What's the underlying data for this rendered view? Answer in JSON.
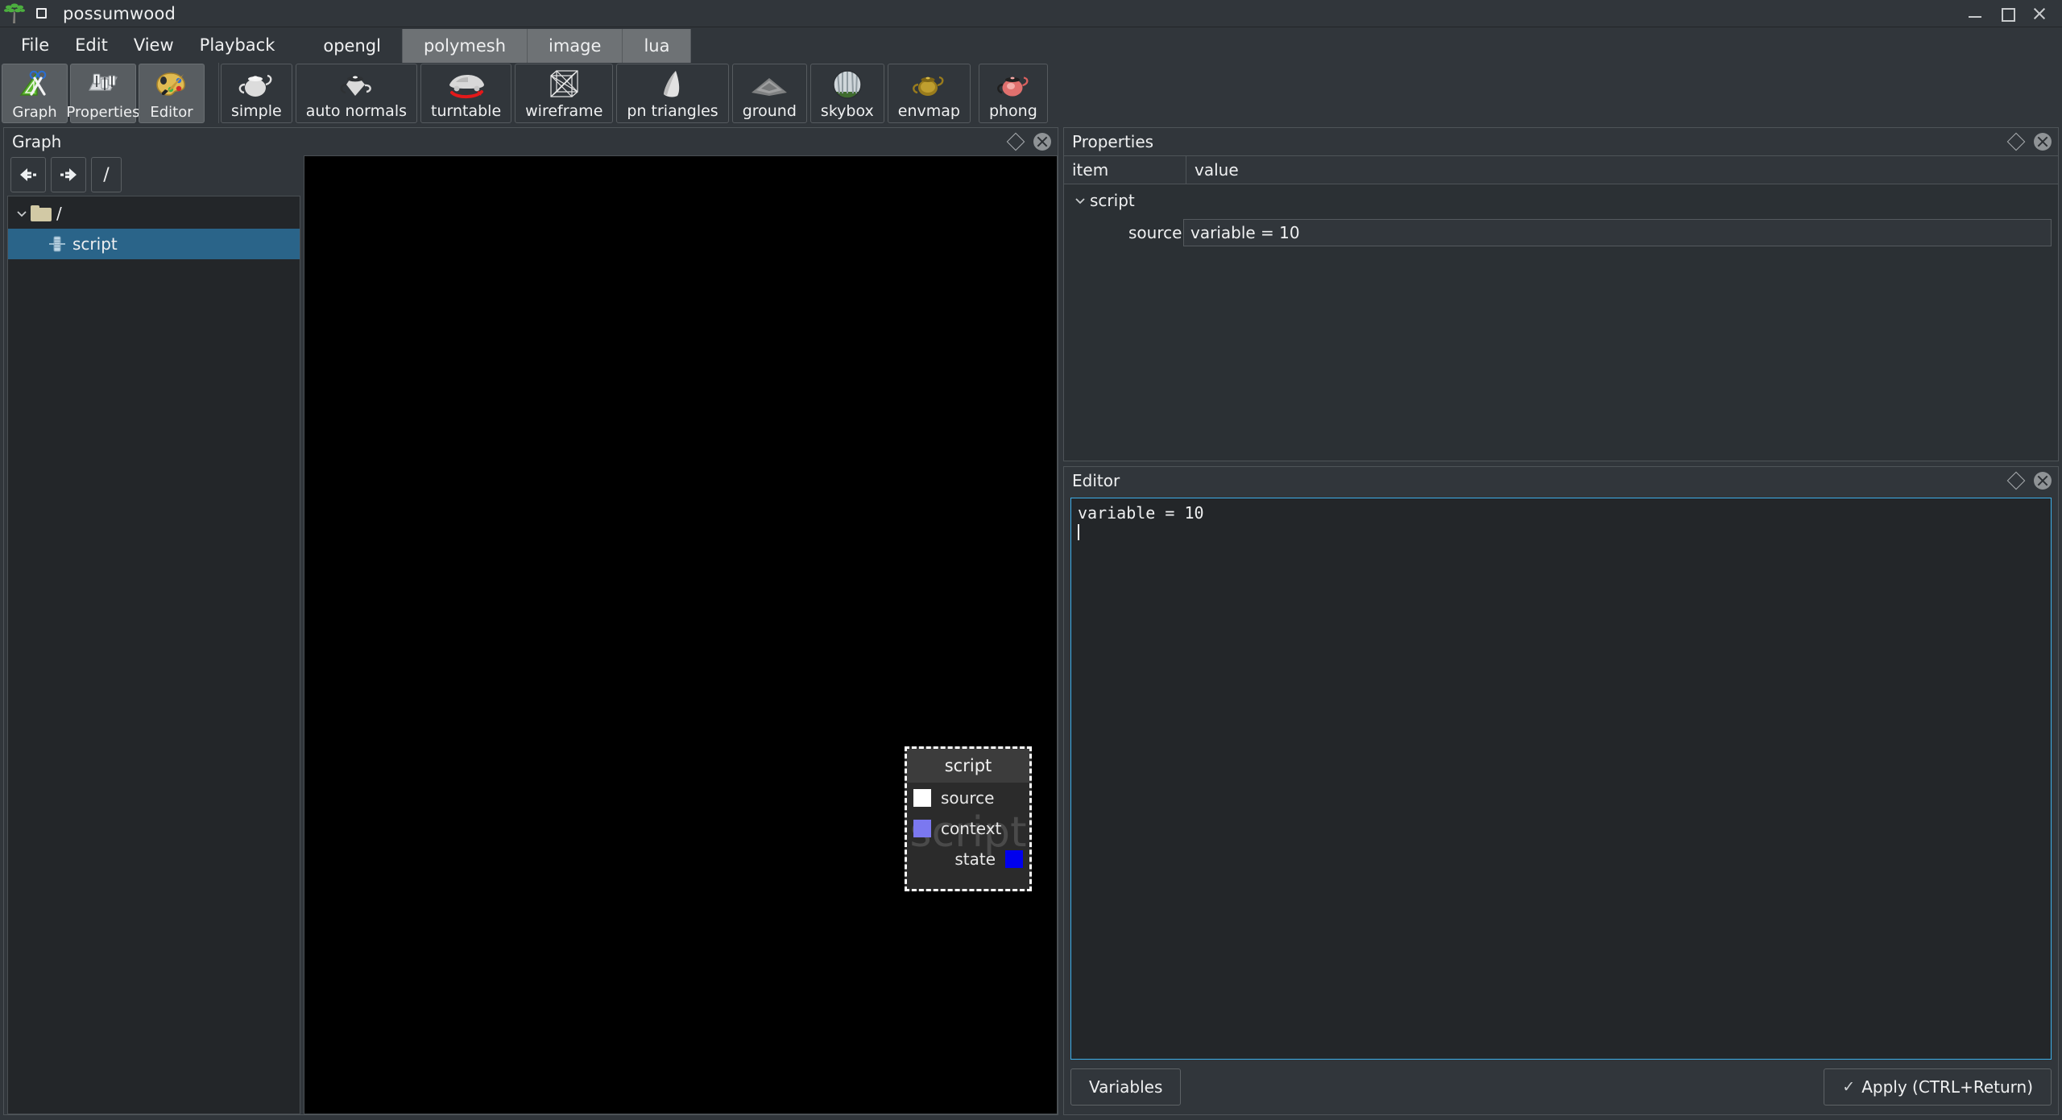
{
  "window": {
    "title": "possumwood",
    "app_icon": "tree-icon",
    "window_icon": "square-icon",
    "controls": {
      "minimize": "minimize-icon",
      "maximize": "maximize-icon",
      "close": "close-icon"
    }
  },
  "menubar": {
    "items": [
      "File",
      "Edit",
      "View",
      "Playback"
    ]
  },
  "tabs": [
    {
      "label": "opengl",
      "active": true
    },
    {
      "label": "polymesh",
      "active": false
    },
    {
      "label": "image",
      "active": false
    },
    {
      "label": "lua",
      "active": false
    }
  ],
  "left_toolbar": [
    {
      "label": "Graph",
      "icon": "ruler-scissors-icon"
    },
    {
      "label": "Properties",
      "icon": "sliders-icon"
    },
    {
      "label": "Editor",
      "icon": "paint-palette-icon"
    }
  ],
  "opengl_toolbar": [
    {
      "label": "simple",
      "icon": "teapot-icon"
    },
    {
      "label": "auto normals",
      "icon": "teapot-faceted-icon"
    },
    {
      "label": "turntable",
      "icon": "car-rotate-icon"
    },
    {
      "label": "wireframe",
      "icon": "wireframe-cube-icon"
    },
    {
      "label": "pn triangles",
      "icon": "cone-icon"
    },
    {
      "label": "ground",
      "icon": "checker-plane-icon"
    },
    {
      "label": "skybox",
      "icon": "sphere-env-icon"
    },
    {
      "label": "envmap",
      "icon": "teapot-gold-icon"
    },
    {
      "label": "phong",
      "icon": "teapot-red-icon"
    }
  ],
  "graph_panel": {
    "title": "Graph",
    "nav": {
      "back": "arrow-left-icon",
      "forward": "arrow-right-icon",
      "path": "/"
    },
    "tree": [
      {
        "label": "/",
        "icon": "folder-icon",
        "depth": 0,
        "expanded": true,
        "selected": false
      },
      {
        "label": "script",
        "icon": "node-icon",
        "depth": 1,
        "expanded": false,
        "selected": true
      }
    ],
    "node": {
      "title": "script",
      "watermark": "script",
      "ports": [
        {
          "name": "source",
          "color": "#ffffff",
          "side": "in"
        },
        {
          "name": "context",
          "color": "#7b78f0",
          "side": "in"
        },
        {
          "name": "state",
          "color": "#0000ee",
          "side": "out"
        }
      ]
    }
  },
  "properties_panel": {
    "title": "Properties",
    "columns": [
      "item",
      "value"
    ],
    "rows": [
      {
        "item": "script",
        "value": "",
        "depth": 0,
        "expandable": true
      },
      {
        "item": "source",
        "value": "variable = 10",
        "depth": 1,
        "expandable": false
      }
    ]
  },
  "editor_panel": {
    "title": "Editor",
    "code": "variable = 10",
    "variables_button": "Variables",
    "apply_button": "Apply (CTRL+Return)",
    "apply_icon": "check-icon"
  },
  "colors": {
    "accent": "#3daee9",
    "selection": "#2a6489",
    "panel_bg": "#31363b",
    "dark_bg": "#232629"
  }
}
